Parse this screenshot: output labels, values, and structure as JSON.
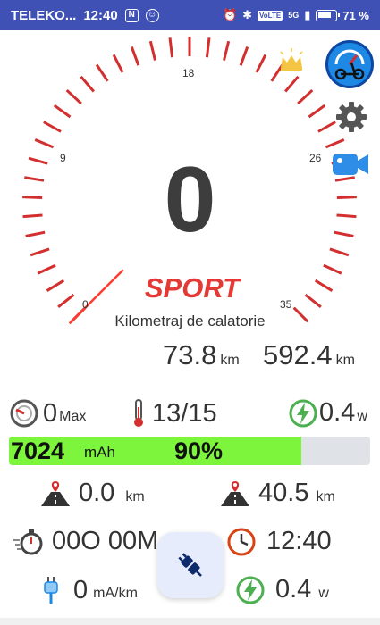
{
  "status": {
    "carrier": "TELEKO...",
    "time": "12:40",
    "battery_pct": "71 %",
    "volte": "VoLTE",
    "network": "5G"
  },
  "gauge": {
    "speed": "0",
    "mode": "SPORT",
    "trip_label": "Kilometraj de calatorie",
    "tick_labels": [
      "0",
      "9",
      "18",
      "26",
      "35"
    ]
  },
  "odometer": {
    "trip_value": "73.8",
    "trip_unit": "km",
    "total_value": "592.4",
    "total_unit": "km"
  },
  "stats": {
    "max_speed": "0",
    "max_label": "Max",
    "temperature": "13/15",
    "power_top": "0.4",
    "power_top_unit": "w",
    "battery_mah": "7024",
    "battery_mah_unit": "mAh",
    "battery_percent": "90%",
    "battery_fraction": 0.9,
    "distance_left": "0.0",
    "distance_left_unit": "km",
    "distance_right": "40.5",
    "distance_right_unit": "km",
    "timer": "00O 00M",
    "clock": "12:40",
    "consumption": "0",
    "consumption_unit": "mA/km",
    "power_bottom": "0.4",
    "power_bottom_unit": "w"
  },
  "colors": {
    "statusbar": "#3f51b5",
    "gauge_ticks": "#d32f2f",
    "mode": "#e53935",
    "battery_fill": "#7cf53c",
    "accent_blue": "#1e88e5"
  }
}
